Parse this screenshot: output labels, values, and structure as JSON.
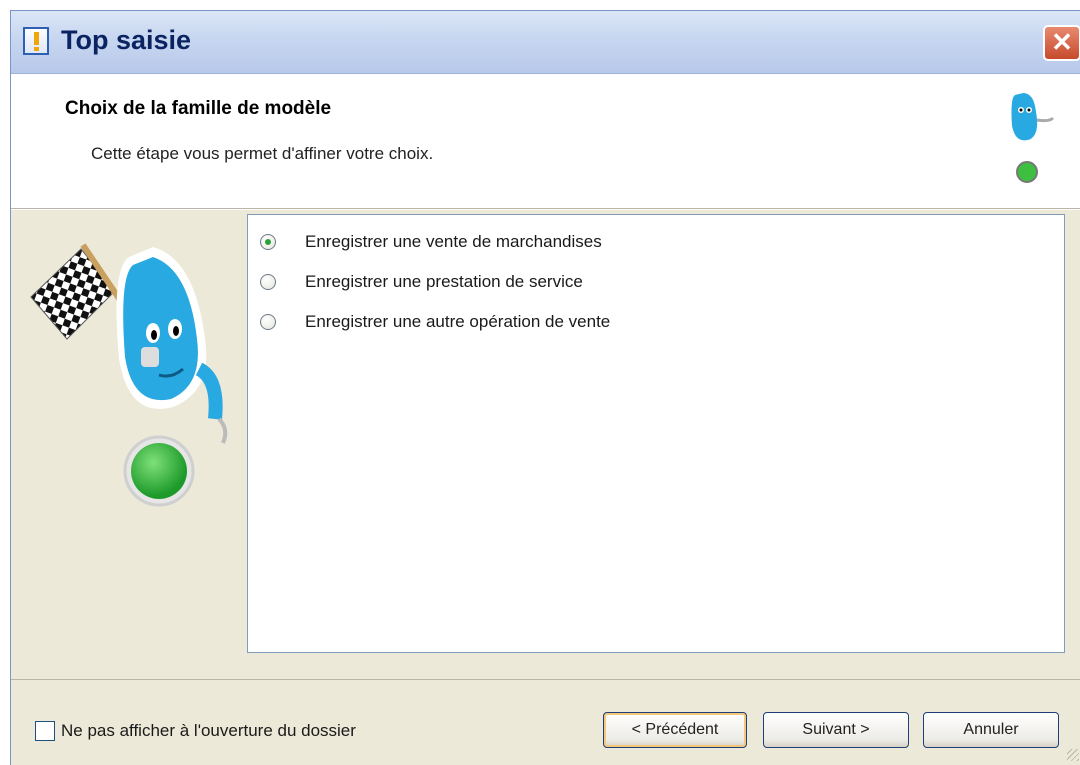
{
  "window": {
    "title": "Top saisie",
    "close_glyph": "✕"
  },
  "header": {
    "title": "Choix de la famille de modèle",
    "subtitle": "Cette étape vous permet d'affiner votre choix."
  },
  "options": [
    {
      "label": "Enregistrer une vente de marchandises",
      "selected": true
    },
    {
      "label": "Enregistrer une prestation de service",
      "selected": false
    },
    {
      "label": "Enregistrer une autre opération de vente",
      "selected": false
    }
  ],
  "footer": {
    "checkbox_label": "Ne pas afficher à l'ouverture du dossier",
    "checkbox_checked": false,
    "prev_label": "< Précédent",
    "next_label": "Suivant >",
    "cancel_label": "Annuler"
  },
  "icons": {
    "title": "app-icon",
    "header": "mascot-icon",
    "side": "mascot-flag-icon"
  },
  "colors": {
    "titlebar": "#c9d8f1",
    "dialog_bg": "#ece9d8",
    "mascot_blue": "#29a9e1",
    "status_green": "#3fbf3f",
    "close_red": "#d9573a"
  }
}
